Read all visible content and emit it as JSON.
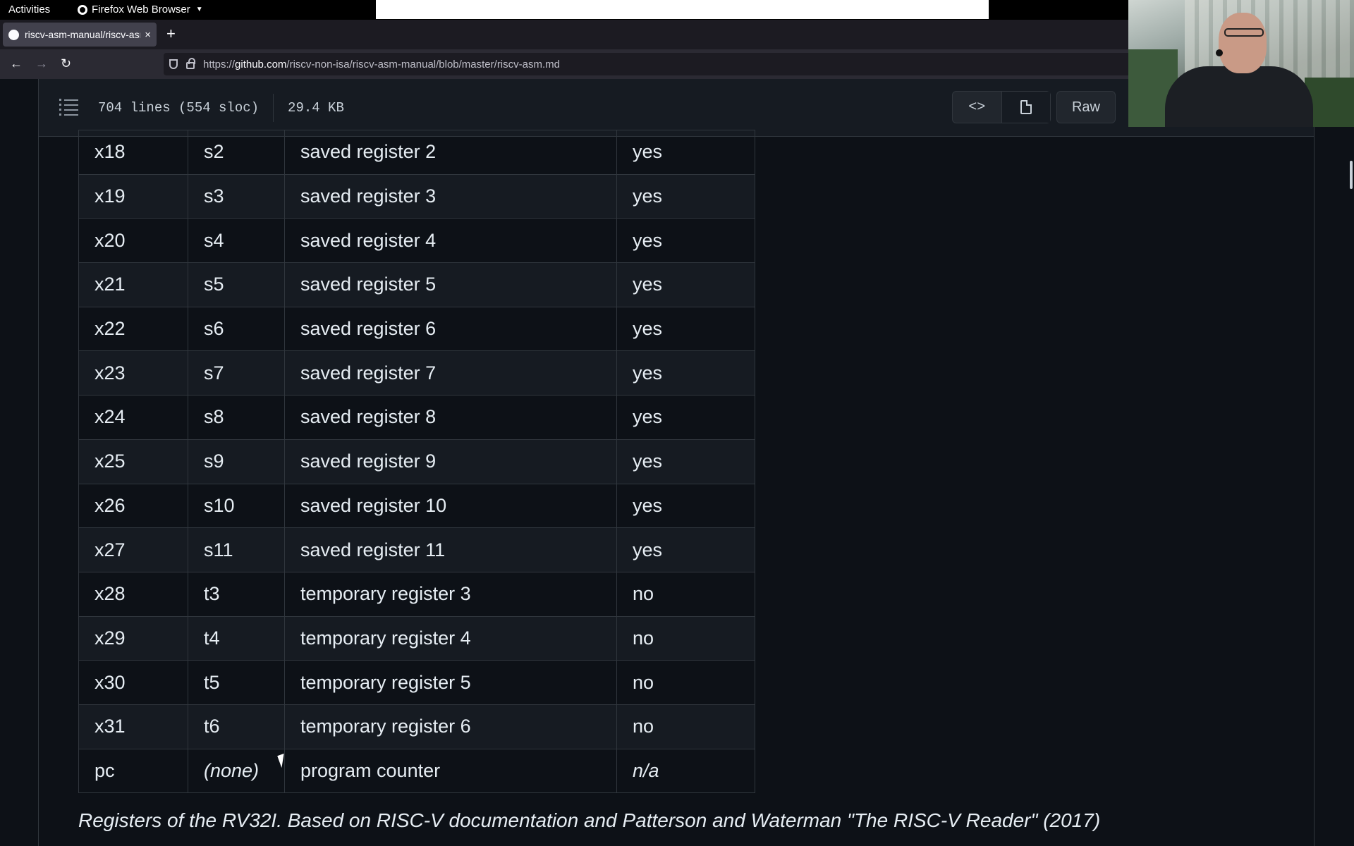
{
  "system": {
    "activities": "Activities",
    "app_name": "Firefox Web Browser"
  },
  "browser": {
    "tab_title": "riscv-asm-manual/riscv-asm.md",
    "url_prefix": "https://",
    "url_host": "github.com",
    "url_path": "/riscv-non-isa/riscv-asm-manual/blob/master/riscv-asm.md"
  },
  "file_header": {
    "lines": "704 lines (554 sloc)",
    "size": "29.4 KB",
    "raw_label": "Raw"
  },
  "table": {
    "rows": [
      [
        "x18",
        "s2",
        "saved register 2",
        "yes"
      ],
      [
        "x19",
        "s3",
        "saved register 3",
        "yes"
      ],
      [
        "x20",
        "s4",
        "saved register 4",
        "yes"
      ],
      [
        "x21",
        "s5",
        "saved register 5",
        "yes"
      ],
      [
        "x22",
        "s6",
        "saved register 6",
        "yes"
      ],
      [
        "x23",
        "s7",
        "saved register 7",
        "yes"
      ],
      [
        "x24",
        "s8",
        "saved register 8",
        "yes"
      ],
      [
        "x25",
        "s9",
        "saved register 9",
        "yes"
      ],
      [
        "x26",
        "s10",
        "saved register 10",
        "yes"
      ],
      [
        "x27",
        "s11",
        "saved register 11",
        "yes"
      ],
      [
        "x28",
        "t3",
        "temporary register 3",
        "no"
      ],
      [
        "x29",
        "t4",
        "temporary register 4",
        "no"
      ],
      [
        "x30",
        "t5",
        "temporary register 5",
        "no"
      ],
      [
        "x31",
        "t6",
        "temporary register 6",
        "no"
      ],
      [
        "pc",
        "(none)",
        "program counter",
        "n/a"
      ]
    ],
    "caption": "Registers of the RV32I. Based on RISC-V documentation and Patterson and Waterman \"The RISC-V Reader\" (2017)"
  },
  "icons": {
    "tab": "github-icon",
    "close": "close-icon",
    "new_tab": "plus-icon",
    "back": "back-arrow-icon",
    "forward": "forward-arrow-icon",
    "reload": "reload-icon",
    "shield": "shield-icon",
    "lock": "lock-icon",
    "outline": "list-icon",
    "code": "code-icon",
    "file": "file-icon"
  },
  "colors": {
    "page_background": "#0d1117",
    "header_background": "#161b22",
    "border": "#30363d",
    "text": "#e6edf3"
  }
}
